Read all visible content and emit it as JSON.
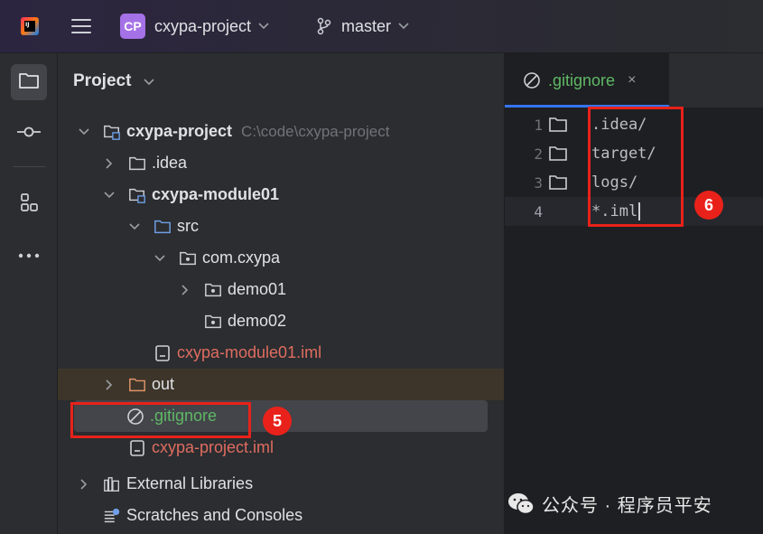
{
  "titlebar": {
    "project_badge": "CP",
    "project_name": "cxypa-project",
    "branch": "master",
    "icons": [
      "jetbrains-logo-icon",
      "hamburger-menu-icon",
      "branch-icon",
      "chevron-down-icon"
    ]
  },
  "project_panel": {
    "title": "Project",
    "tree": [
      {
        "label": "cxypa-project",
        "path": "C:\\code\\cxypa-project",
        "expanded": true,
        "icon": "module-folder-icon"
      },
      {
        "label": ".idea",
        "expanded": false,
        "icon": "folder-icon"
      },
      {
        "label": "cxypa-module01",
        "expanded": true,
        "icon": "module-folder-icon"
      },
      {
        "label": "src",
        "expanded": true,
        "icon": "source-folder-icon"
      },
      {
        "label": "com.cxypa",
        "expanded": true,
        "icon": "package-icon"
      },
      {
        "label": "demo01",
        "expanded": false,
        "icon": "package-icon"
      },
      {
        "label": "demo02",
        "icon": "package-icon"
      },
      {
        "label": "cxypa-module01.iml",
        "icon": "iml-file-icon",
        "color": "#e06c60"
      },
      {
        "label": "out",
        "expanded": false,
        "icon": "excluded-folder-icon"
      },
      {
        "label": ".gitignore",
        "icon": "ignore-file-icon",
        "color": "#5fb865"
      },
      {
        "label": "cxypa-project.iml",
        "icon": "iml-file-icon",
        "color": "#e06c60"
      },
      {
        "label": "External Libraries",
        "expanded": false,
        "icon": "libraries-icon"
      },
      {
        "label": "Scratches and Consoles",
        "icon": "scratches-icon"
      }
    ]
  },
  "editor": {
    "tab_label": ".gitignore",
    "tab_close": "×",
    "lines": [
      {
        "num": "1",
        "text": ".idea/"
      },
      {
        "num": "2",
        "text": "target/"
      },
      {
        "num": "3",
        "text": "logs/"
      },
      {
        "num": "4",
        "text": "*.iml"
      }
    ]
  },
  "annotations": {
    "badge_5": "5",
    "badge_6": "6",
    "color": "#e8221a"
  },
  "watermark": "公众号 · 程序员平安",
  "colors": {
    "accent": "#3574f0",
    "ignored_green": "#5fb865",
    "iml_red": "#e06c60",
    "project_badge": "#a571e6"
  }
}
